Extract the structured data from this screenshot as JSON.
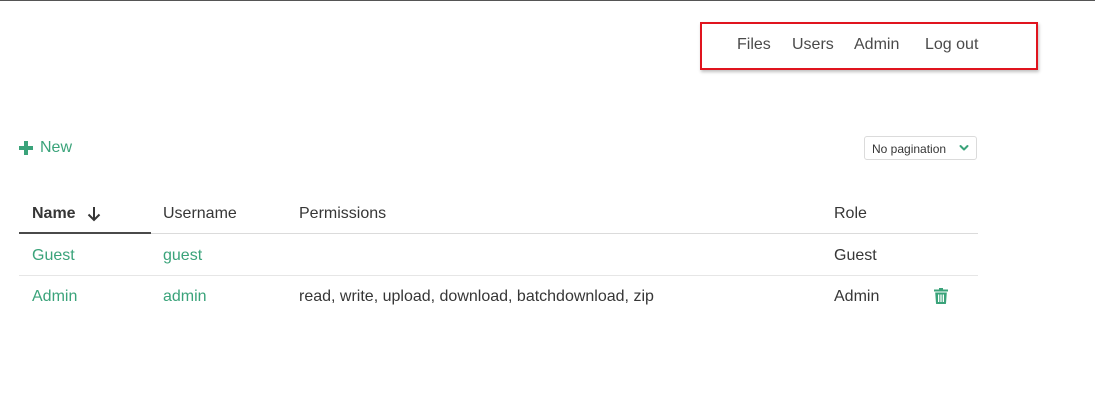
{
  "nav": {
    "items": [
      {
        "label": "Files"
      },
      {
        "label": "Users"
      },
      {
        "label": "Admin"
      },
      {
        "label": "Log out"
      }
    ]
  },
  "toolbar": {
    "new_label": "New",
    "pagination_value": "No pagination"
  },
  "table": {
    "columns": [
      "Name",
      "Username",
      "Permissions",
      "Role"
    ],
    "sort_column": "Name",
    "sort_direction": "descending",
    "rows": [
      {
        "name": "Guest",
        "username": "guest",
        "permissions": "",
        "role": "Guest",
        "deletable": false
      },
      {
        "name": "Admin",
        "username": "admin",
        "permissions": "read, write, upload, download, batchdownload, zip",
        "role": "Admin",
        "deletable": true
      }
    ]
  },
  "colors": {
    "accent": "#3aa37a",
    "highlight_border": "#e0141e",
    "text": "#363636"
  },
  "icons": {
    "new": "plus-icon",
    "sort": "arrow-down-icon",
    "pager": "chevron-down-icon",
    "delete": "trash-icon"
  }
}
